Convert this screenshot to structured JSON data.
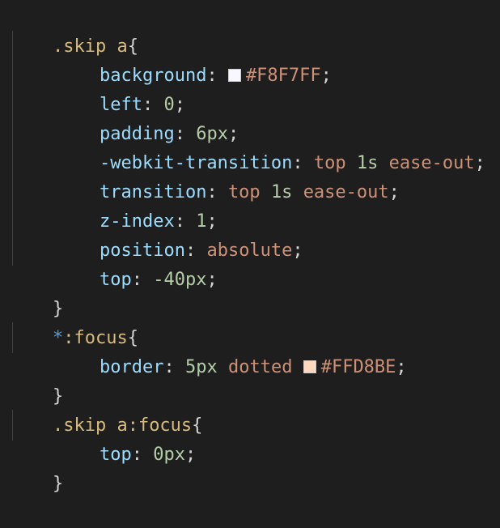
{
  "code": {
    "rules": [
      {
        "selector": ".skip a",
        "declarations": [
          {
            "property": "background",
            "color_value": "#F8F7FF",
            "swatch": "#F8F7FF"
          },
          {
            "property": "left",
            "value": "0"
          },
          {
            "property": "padding",
            "value": "6px"
          },
          {
            "property": "-webkit-transition",
            "value_parts": [
              "top",
              "1s",
              "ease-out"
            ]
          },
          {
            "property": "transition",
            "value_parts": [
              "top",
              "1s",
              "ease-out"
            ]
          },
          {
            "property": "z-index",
            "value": "1"
          },
          {
            "property": "position",
            "value": "absolute"
          },
          {
            "property": "top",
            "value": "-40px"
          }
        ]
      },
      {
        "selector_star": "*",
        "selector": ":focus",
        "declarations": [
          {
            "property": "border",
            "value_parts": [
              "5px",
              "dotted"
            ],
            "color_value": "#FFD8BE",
            "swatch": "#FFD8BE"
          }
        ]
      },
      {
        "selector": ".skip a:focus",
        "declarations": [
          {
            "property": "top",
            "value": "0px"
          }
        ]
      }
    ],
    "open_brace": "{",
    "close_brace": "}",
    "colon": ":",
    "semicolon": ";"
  }
}
